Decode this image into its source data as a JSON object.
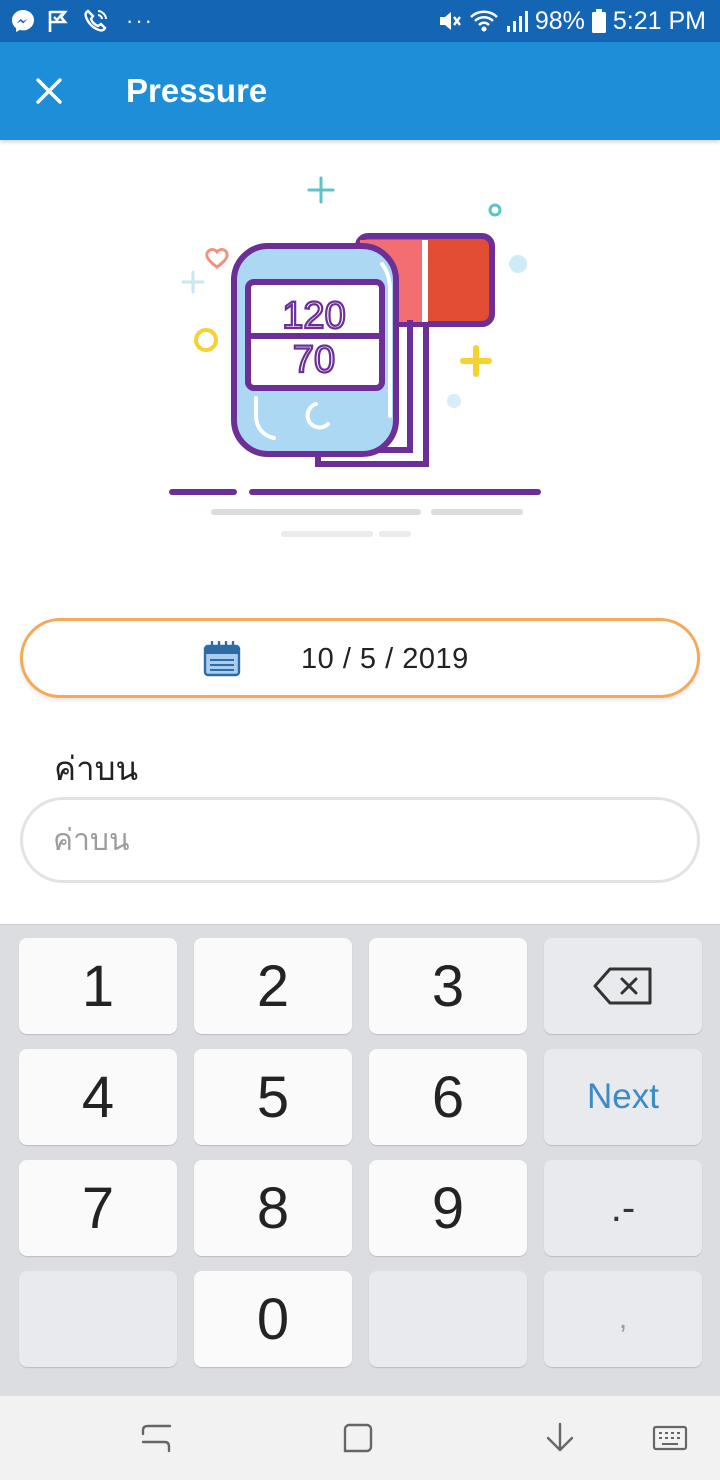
{
  "status_bar": {
    "battery": "98%",
    "time": "5:21 PM",
    "icons": [
      "messenger-icon",
      "check-flag-icon",
      "phone-call-icon",
      "more-dots-icon",
      "mute-icon",
      "wifi-icon",
      "signal-icon",
      "battery-icon"
    ],
    "dots": "···"
  },
  "app_bar": {
    "title": "Pressure",
    "close_icon": "close-icon",
    "color": "#1f8ed8"
  },
  "illustration": {
    "display_top": "120",
    "display_bottom": "70"
  },
  "date_field": {
    "icon": "calendar-icon",
    "value": "10 / 5 / 2019",
    "border_color": "#f4a95b"
  },
  "upper_value_field": {
    "label": "ค่าบน",
    "placeholder": "ค่าบน",
    "value": ""
  },
  "keyboard": {
    "keys": {
      "k1": "1",
      "k2": "2",
      "k3": "3",
      "k4": "4",
      "k5": "5",
      "k6": "6",
      "k7": "7",
      "k8": "8",
      "k9": "9",
      "k0": "0",
      "next": "Next",
      "symbol": ".-",
      "comma": ","
    },
    "backspace_icon": "backspace-icon"
  },
  "nav_bar": {
    "icons": [
      "recent-apps-icon",
      "home-icon",
      "hide-keyboard-icon",
      "keyboard-icon"
    ]
  }
}
